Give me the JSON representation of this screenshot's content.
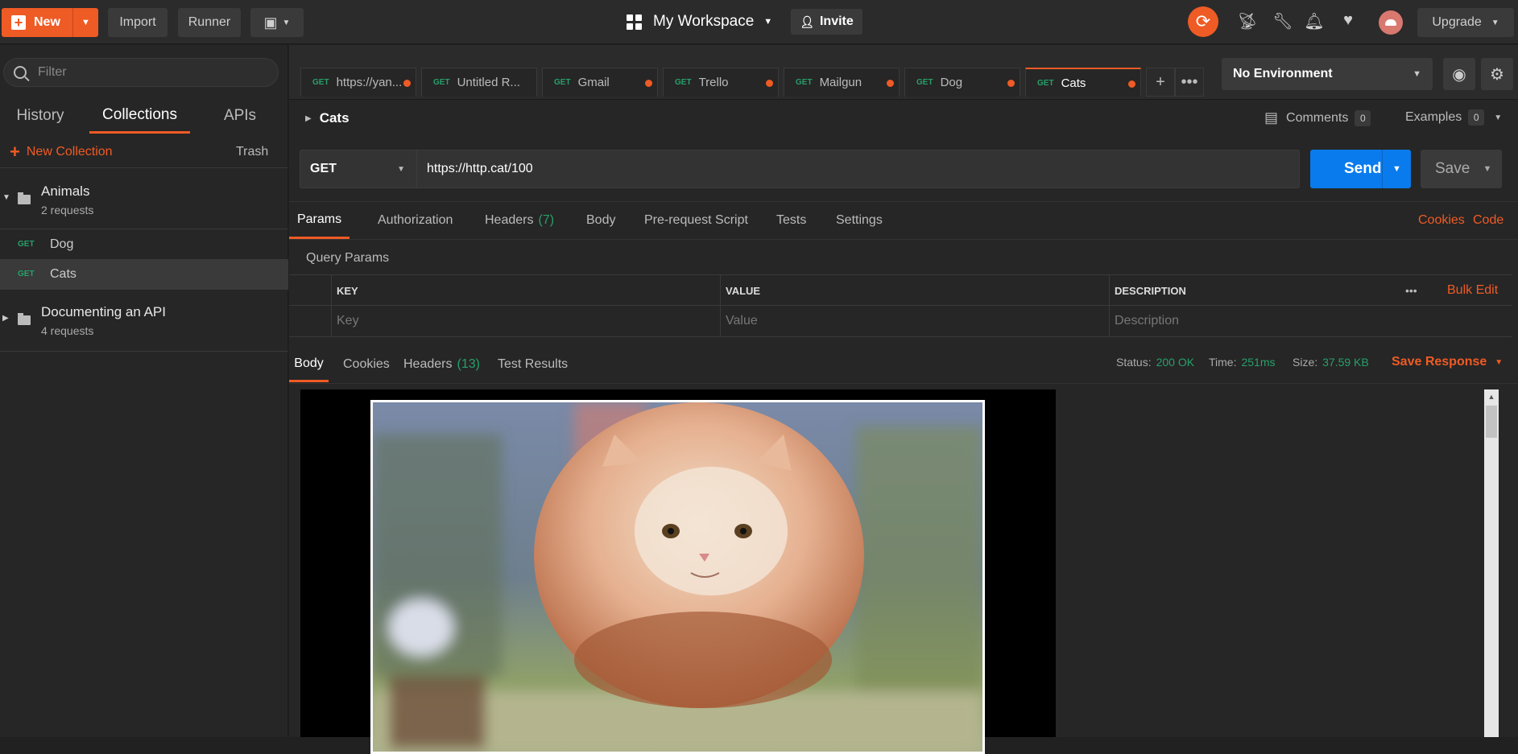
{
  "topbar": {
    "new_label": "New",
    "import_label": "Import",
    "runner_label": "Runner",
    "workspace_label": "My Workspace",
    "invite_label": "Invite",
    "upgrade_label": "Upgrade"
  },
  "sidebar": {
    "filter_placeholder": "Filter",
    "tabs": [
      "History",
      "Collections",
      "APIs"
    ],
    "active_tab": "Collections",
    "new_collection_label": "New Collection",
    "trash_label": "Trash",
    "collections": [
      {
        "name": "Animals",
        "count": "2 requests",
        "expanded": true,
        "requests": [
          {
            "method": "GET",
            "name": "Dog"
          },
          {
            "method": "GET",
            "name": "Cats",
            "selected": true
          }
        ]
      },
      {
        "name": "Documenting an API",
        "count": "4 requests",
        "expanded": false
      }
    ]
  },
  "request_tabs": [
    {
      "method": "GET",
      "title": "https://yan...",
      "dirty": true
    },
    {
      "method": "GET",
      "title": "Untitled R...",
      "dirty": false
    },
    {
      "method": "GET",
      "title": "Gmail",
      "dirty": true
    },
    {
      "method": "GET",
      "title": "Trello",
      "dirty": true
    },
    {
      "method": "GET",
      "title": "Mailgun",
      "dirty": true
    },
    {
      "method": "GET",
      "title": "Dog",
      "dirty": true
    },
    {
      "method": "GET",
      "title": "Cats",
      "dirty": true,
      "active": true
    }
  ],
  "environment": {
    "selected": "No Environment"
  },
  "request": {
    "name": "Cats",
    "comments_label": "Comments",
    "comments_count": "0",
    "examples_label": "Examples",
    "examples_count": "0",
    "method": "GET",
    "url": "https://http.cat/100",
    "send_label": "Send",
    "save_label": "Save",
    "tabs": {
      "params": "Params",
      "authorization": "Authorization",
      "headers": "Headers",
      "headers_count": "(7)",
      "body": "Body",
      "prerequest": "Pre-request Script",
      "tests": "Tests",
      "settings": "Settings",
      "cookies": "Cookies",
      "code": "Code"
    },
    "query_params_label": "Query Params",
    "table": {
      "headers": [
        "KEY",
        "VALUE",
        "DESCRIPTION"
      ],
      "bulk_edit": "Bulk Edit",
      "placeholders": [
        "Key",
        "Value",
        "Description"
      ]
    }
  },
  "response": {
    "tabs": {
      "body": "Body",
      "cookies": "Cookies",
      "headers": "Headers",
      "headers_count": "(13)",
      "test_results": "Test Results"
    },
    "status_label": "Status:",
    "status_value": "200 OK",
    "time_label": "Time:",
    "time_value": "251ms",
    "size_label": "Size:",
    "size_value": "37.59 KB",
    "save_response_label": "Save Response"
  },
  "colors": {
    "accent": "#ef5b25",
    "send_blue": "#097bed",
    "get_green": "#27a06a"
  }
}
